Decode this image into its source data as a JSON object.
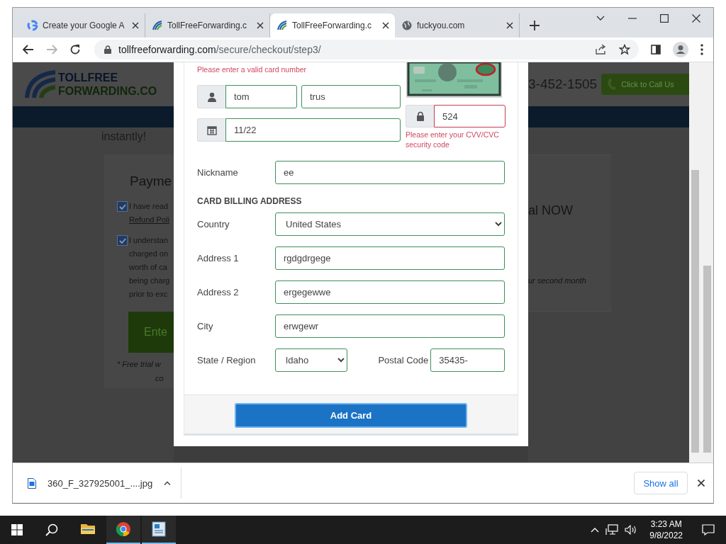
{
  "browser": {
    "tabs": [
      {
        "title": "Create your Google A",
        "selected": false
      },
      {
        "title": "TollFreeForwarding.c",
        "selected": false
      },
      {
        "title": "TollFreeForwarding.c",
        "selected": true
      },
      {
        "title": "fuckyou.com",
        "selected": false
      }
    ],
    "address": {
      "host": "tollfreeforwarding.com",
      "path": "/secure/checkout/step3/"
    },
    "forward_disabled": true
  },
  "page": {
    "logo": {
      "line1": "TOLLFREE",
      "line2": "FORWARDING.CO"
    },
    "phone": "3-452-1505",
    "call_button": "Click to Call Us",
    "intro": "instantly!",
    "payment": {
      "heading": "Payme",
      "agreements": [
        {
          "checked": true,
          "lines": [
            "I have read"
          ],
          "link": "Refund Poli"
        },
        {
          "checked": true,
          "lines": [
            "I understan",
            "charged on",
            "worth of ca",
            "being charg",
            "prior to exc"
          ]
        }
      ],
      "button": "Ente",
      "note_lines": [
        "* Free trial w",
        "co"
      ]
    },
    "side": {
      "heading": "al NOW",
      "note": "ur second month"
    }
  },
  "modal": {
    "card_error": "Please enter a valid card number",
    "first_name": {
      "value": "tom",
      "invalid": false
    },
    "last_name": {
      "value": "trus",
      "invalid": false
    },
    "expiry": {
      "value": "11/22",
      "invalid": false
    },
    "cvv": {
      "value": "524",
      "invalid": true,
      "error": "Please enter your CVV/CVC security code"
    },
    "rows": [
      {
        "kind": "text",
        "label": "Nickname",
        "value": "ee",
        "invalid": false
      },
      {
        "kind": "heading",
        "label": "CARD BILLING ADDRESS"
      },
      {
        "kind": "select",
        "label": "Country",
        "value": "United States",
        "invalid": false
      },
      {
        "kind": "text",
        "label": "Address 1",
        "value": "rgdgdrgege",
        "invalid": false
      },
      {
        "kind": "text",
        "label": "Address 2",
        "value": "ergegewwe",
        "invalid": false
      },
      {
        "kind": "text",
        "label": "City",
        "value": "erwgewr",
        "invalid": false
      }
    ],
    "state": {
      "label": "State / Region",
      "value": "Idaho",
      "invalid": false
    },
    "postal": {
      "label": "Postal Code",
      "value": "35435-",
      "invalid": false
    },
    "submit": "Add Card"
  },
  "downloads": {
    "file": "360_F_327925001_....jpg",
    "show_all": "Show all"
  },
  "taskbar": {
    "apps": [
      {
        "running": false
      },
      {
        "running": true
      },
      {
        "running": true
      }
    ],
    "time": "3:23 AM",
    "date": "9/8/2022"
  }
}
